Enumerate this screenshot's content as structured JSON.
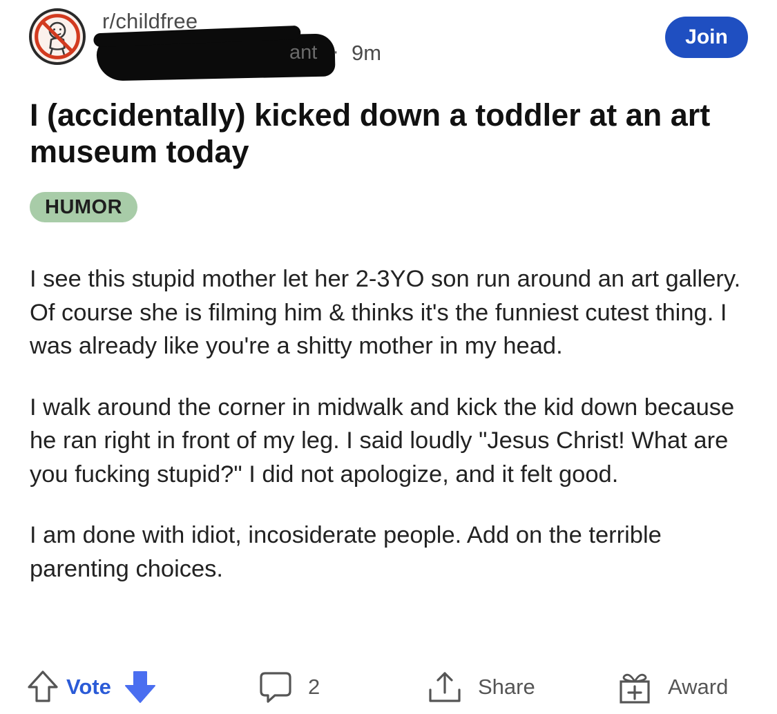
{
  "header": {
    "subreddit": "r/childfree",
    "username_visible": "ant",
    "separator": "·",
    "age": "9m",
    "join_label": "Join"
  },
  "post": {
    "title": "I (accidentally) kicked down a toddler at an art museum today",
    "flair": "HUMOR",
    "body": [
      "I see this stupid mother let her 2-3YO son run around an art gallery. Of course she is filming him & thinks it's the funniest cutest thing. I was already like you're a shitty mother in my head.",
      "I walk around the corner in midwalk and kick the kid down because he ran right in front of my leg. I said loudly \"Jesus Christ! What are you fucking stupid?\" I did not apologize, and it felt good.",
      "I am done with idiot, incosiderate people. Add on the terrible parenting choices."
    ]
  },
  "actions": {
    "vote_label": "Vote",
    "comment_count": "2",
    "share_label": "Share",
    "award_label": "Award"
  },
  "icons": {
    "avatar": "no-baby-logo-icon",
    "upvote": "upvote-arrow-icon",
    "downvote": "downvote-arrow-icon",
    "comment": "comment-bubble-icon",
    "share": "share-icon",
    "award": "award-gift-icon"
  },
  "colors": {
    "join_button": "#1f4fc1",
    "vote_accent": "#2b5bd7",
    "flair_background": "#a8cca8",
    "avatar_ring": "#d23a1f"
  }
}
